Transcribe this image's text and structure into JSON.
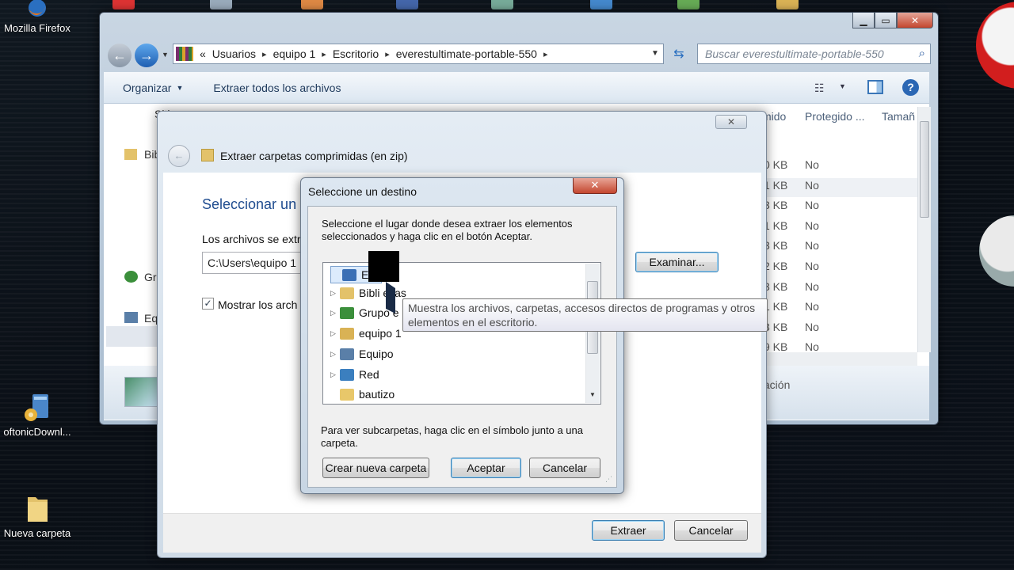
{
  "desktop": {
    "icons": [
      {
        "label": "Mozilla Firefox"
      },
      {
        "label": "oftonicDownl..."
      },
      {
        "label": "Nueva carpeta"
      }
    ]
  },
  "explorer": {
    "address": {
      "crumbs": [
        "Usuarios",
        "equipo 1",
        "Escritorio",
        "everestultimate-portable-550"
      ],
      "prefix": "«"
    },
    "search_placeholder": "Buscar everestultimate-portable-550",
    "toolbar": {
      "organize": "Organizar",
      "extract_all": "Extraer todos los archivos"
    },
    "columns": {
      "partial_a": "mido",
      "protected": "Protegido ...",
      "size": "Tamañ"
    },
    "rows": [
      {
        "size": "0 KB",
        "protected": "No"
      },
      {
        "size": "1 KB",
        "protected": "No"
      },
      {
        "size": "3 KB",
        "protected": "No"
      },
      {
        "size": "1 KB",
        "protected": "No"
      },
      {
        "size": "3 KB",
        "protected": "No"
      },
      {
        "size": "2 KB",
        "protected": "No"
      },
      {
        "size": "3 KB",
        "protected": "No"
      },
      {
        "size": "1 KB",
        "protected": "No"
      },
      {
        "size": "3 KB",
        "protected": "No"
      },
      {
        "size": "9 KB",
        "protected": "No"
      }
    ],
    "nav_partial": {
      "sitios": "Siti",
      "biblio": "Bibl",
      "grupo": "Gr",
      "equipo": "Equi"
    },
    "status_partial": "tación"
  },
  "wizard": {
    "title": "Extraer carpetas comprimidas (en zip)",
    "heading": "Seleccionar un",
    "files_label": "Los archivos se extr",
    "path_value": "C:\\Users\\equipo 1",
    "browse": "Examinar...",
    "show_label": "Mostrar los arch",
    "extract": "Extraer",
    "cancel": "Cancelar"
  },
  "dialog": {
    "title": "Seleccione un destino",
    "instructions": "Seleccione el lugar donde desea extraer los elementos seleccionados y haga clic en el botón Aceptar.",
    "tree": [
      {
        "label": "Esc",
        "selected": true,
        "icon": "desktop-icon"
      },
      {
        "label": "Bibli     ecas",
        "icon": "libraries-icon"
      },
      {
        "label": "Grupo e",
        "icon": "homegroup-icon"
      },
      {
        "label": "equipo 1",
        "icon": "user-folder-icon"
      },
      {
        "label": "Equipo",
        "icon": "computer-icon"
      },
      {
        "label": "Red",
        "icon": "network-icon"
      },
      {
        "label": "bautizo",
        "icon": "folder-icon"
      }
    ],
    "hint": "Para ver subcarpetas, haga clic en el símbolo junto a una carpeta.",
    "new_folder": "Crear nueva carpeta",
    "ok": "Aceptar",
    "cancel": "Cancelar",
    "tooltip": "Muestra los archivos, carpetas, accesos directos de programas y otros elementos en el escritorio."
  },
  "colors": {
    "accent": "#1e395b",
    "close_red": "#c4472f",
    "desktop": "#0b1119"
  }
}
